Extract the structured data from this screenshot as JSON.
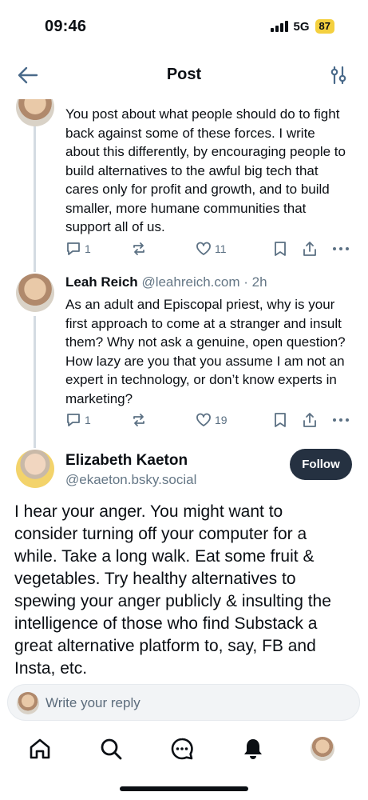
{
  "status_bar": {
    "time": "09:46",
    "network": "5G",
    "battery": "87"
  },
  "header": {
    "title": "Post"
  },
  "thread": [
    {
      "text": "You post about what people should do to fight back against some of these forces. I write about this differently, by encouraging people to build alternatives to the awful big tech that cares only for profit and growth, and to build smaller, more humane communities that support all of us.",
      "replies": "1",
      "likes": "11"
    },
    {
      "author_name": "Leah Reich",
      "author_handle": "@leahreich.com",
      "time_ago": "· 2h",
      "text": "As an adult and Episcopal priest, why is your first approach to come at a stranger and insult them? Why not ask a genuine, open question? How lazy are you that you assume I am not an expert in technology, or don’t know experts in marketing?",
      "replies": "1",
      "likes": "19"
    }
  ],
  "main_post": {
    "author_name": "Elizabeth Kaeton",
    "author_handle": "@ekaeton.bsky.social",
    "follow_label": "Follow",
    "text": "I hear your anger. You might want to consider turning off your computer for a while. Take a long walk. Eat some fruit & vegetables. Try healthy alternatives to spewing your anger publicly & insulting the intelligence of those who find Substack a great alternative platform to, say, FB and Insta, etc."
  },
  "reply_bar": {
    "placeholder": "Write your reply"
  },
  "tabs": [
    "home-icon",
    "search-icon",
    "chat-icon",
    "notifications-icon",
    "profile-avatar"
  ],
  "colors": {
    "follow_bg": "#253141",
    "battery": "#f4d03f",
    "muted": "#657786",
    "thread_line": "#d4dbe2"
  }
}
